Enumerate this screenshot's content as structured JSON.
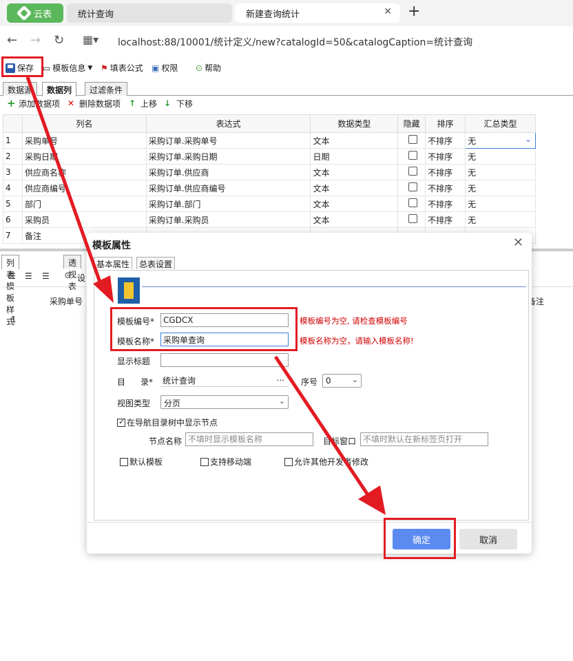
{
  "browser": {
    "app_tab": "云表",
    "tabs": [
      {
        "label": "统计查询"
      },
      {
        "label": "新建查询统计"
      }
    ],
    "url": "localhost:88/10001/统计定义/new?catalogId=50&catalogCaption=统计查询"
  },
  "toolbar": {
    "save": "保存",
    "template_info": "模板信息",
    "fill_formula": "填表公式",
    "permission": "权限",
    "help": "帮助"
  },
  "view_tabs": [
    "数据源",
    "数据列",
    "过滤条件"
  ],
  "actions": {
    "add": "添加数据项",
    "remove": "删除数据项",
    "up": "上移",
    "down": "下移"
  },
  "grid": {
    "headers": [
      "列名",
      "表达式",
      "数据类型",
      "隐藏",
      "排序",
      "汇总类型"
    ],
    "rows": [
      {
        "num": "1",
        "name": "采购单号",
        "expr": "采购订单.采购单号",
        "type": "文本",
        "sort": "不排序",
        "agg": "无"
      },
      {
        "num": "2",
        "name": "采购日期",
        "expr": "采购订单.采购日期",
        "type": "日期",
        "sort": "不排序",
        "agg": "无"
      },
      {
        "num": "3",
        "name": "供应商名称",
        "expr": "采购订单.供应商",
        "type": "文本",
        "sort": "不排序",
        "agg": "无"
      },
      {
        "num": "4",
        "name": "供应商编号",
        "expr": "采购订单.供应商编号",
        "type": "文本",
        "sort": "不排序",
        "agg": "无"
      },
      {
        "num": "5",
        "name": "部门",
        "expr": "采购订单.部门",
        "type": "文本",
        "sort": "不排序",
        "agg": "无"
      },
      {
        "num": "6",
        "name": "采购员",
        "expr": "采购订单.采购员",
        "type": "文本",
        "sort": "不排序",
        "agg": "无"
      },
      {
        "num": "7",
        "name": "备注",
        "expr": "",
        "type": "",
        "sort": "",
        "agg": ""
      }
    ]
  },
  "lower": {
    "tabs": [
      "列表模板样式",
      "透视表"
    ],
    "settings": "设",
    "col1": "采购单号",
    "col2": "备注",
    "row_num": "1"
  },
  "modal": {
    "title": "模板属性",
    "tabs": [
      "基本属性",
      "总表设置"
    ],
    "code_label": "模板编号*",
    "code_value": "CGDCX",
    "code_error": "模板编号为空, 请检查模板编号",
    "name_label": "模板名称*",
    "name_value": "采购单查询",
    "name_error": "模板名称为空，请输入模板名称!",
    "show_title_label": "显示标题",
    "catalog_label_a": "目",
    "catalog_label_b": "录*",
    "catalog_value": "统计查询",
    "ellipsis": "...",
    "seq_label": "序号",
    "seq_value": "0",
    "view_type_label": "视图类型",
    "view_type_value": "分页",
    "show_in_nav": "在导航目录树中显示节点",
    "node_name_label": "节点名称",
    "node_name_placeholder": "不填时显示模板名称",
    "target_window_label": "目标窗口",
    "target_window_placeholder": "不填时默认在新标签页打开",
    "default_template": "默认模板",
    "mobile_support": "支持移动端",
    "allow_modify": "允许其他开发者修改",
    "ok": "确定",
    "cancel": "取消"
  }
}
